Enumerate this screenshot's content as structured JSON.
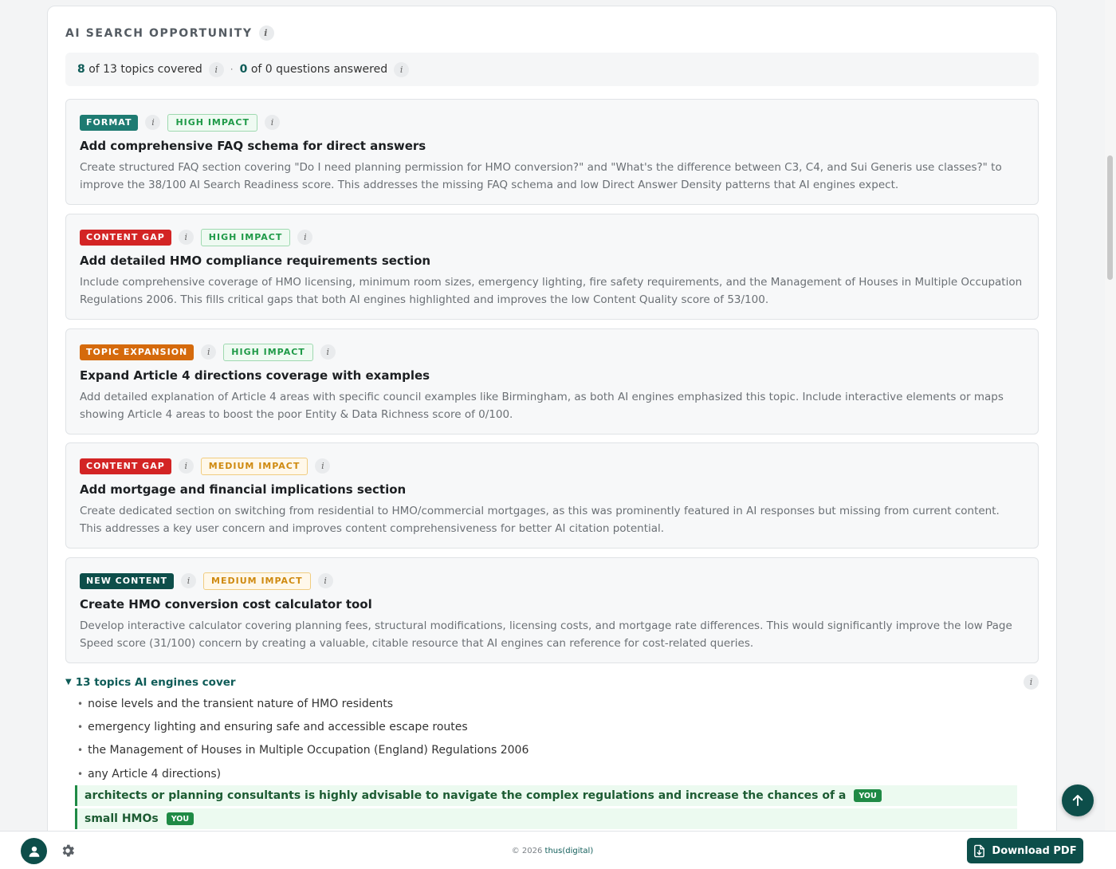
{
  "section": {
    "title": "AI SEARCH OPPORTUNITY"
  },
  "summary": {
    "topics_covered": "8",
    "topics_text": "of 13 topics covered",
    "separator": "·",
    "questions_answered": "0",
    "questions_text": "of 0 questions answered"
  },
  "recommendations": [
    {
      "tag": "FORMAT",
      "tag_color": "#1e7b72",
      "impact": "HIGH IMPACT",
      "title": "Add comprehensive FAQ schema for direct answers",
      "description": "Create structured FAQ section covering \"Do I need planning permission for HMO conversion?\" and \"What's the difference between C3, C4, and Sui Generis use classes?\" to improve the 38/100 AI Search Readiness score. This addresses the missing FAQ schema and low Direct Answer Density patterns that AI engines expect."
    },
    {
      "tag": "CONTENT GAP",
      "tag_color": "#d32424",
      "impact": "HIGH IMPACT",
      "title": "Add detailed HMO compliance requirements section",
      "description": "Include comprehensive coverage of HMO licensing, minimum room sizes, emergency lighting, fire safety requirements, and the Management of Houses in Multiple Occupation Regulations 2006. This fills critical gaps that both AI engines highlighted and improves the low Content Quality score of 53/100."
    },
    {
      "tag": "TOPIC EXPANSION",
      "tag_color": "#d56a0c",
      "impact": "HIGH IMPACT",
      "title": "Expand Article 4 directions coverage with examples",
      "description": "Add detailed explanation of Article 4 areas with specific council examples like Birmingham, as both AI engines emphasized this topic. Include interactive elements or maps showing Article 4 areas to boost the poor Entity & Data Richness score of 0/100."
    },
    {
      "tag": "CONTENT GAP",
      "tag_color": "#d32424",
      "impact": "MEDIUM IMPACT",
      "title": "Add mortgage and financial implications section",
      "description": "Create dedicated section on switching from residential to HMO/commercial mortgages, as this was prominently featured in AI responses but missing from current content. This addresses a key user concern and improves content comprehensiveness for better AI citation potential."
    },
    {
      "tag": "NEW CONTENT",
      "tag_color": "#0d4e4a",
      "impact": "MEDIUM IMPACT",
      "title": "Create HMO conversion cost calculator tool",
      "description": "Develop interactive calculator covering planning fees, structural modifications, licensing costs, and mortgage rate differences. This would significantly improve the low Page Speed score (31/100) concern by creating a valuable, citable resource that AI engines can reference for cost-related queries."
    }
  ],
  "topics": {
    "toggle_label": "13 topics AI engines cover",
    "bullet": "•",
    "you_label": "YOU",
    "items": [
      {
        "text": "noise levels and the transient nature of HMO residents",
        "you": false
      },
      {
        "text": "emergency lighting and ensuring safe and accessible escape routes",
        "you": false
      },
      {
        "text": "the Management of Houses in Multiple Occupation (England) Regulations 2006",
        "you": false
      },
      {
        "text": "any Article 4 directions)",
        "you": false
      },
      {
        "text": "architects or planning consultants is highly advisable to navigate the complex regulations and increase the chances of a",
        "you": true
      },
      {
        "text": "small HMOs",
        "you": true
      }
    ]
  },
  "footer": {
    "copyright_prefix": "© 2026 ",
    "brand": "thus(digital)",
    "download_label": "Download PDF"
  },
  "icons": {
    "info": "info-icon",
    "back_to_top": "arrow-up-icon",
    "avatar": "user-icon",
    "settings": "gear-icon",
    "download": "file-download-icon"
  },
  "colors": {
    "brand": "#0d4e4a",
    "high_impact": "#1f9a48",
    "medium_impact": "#cf8a10",
    "you": "#1f8a45"
  }
}
